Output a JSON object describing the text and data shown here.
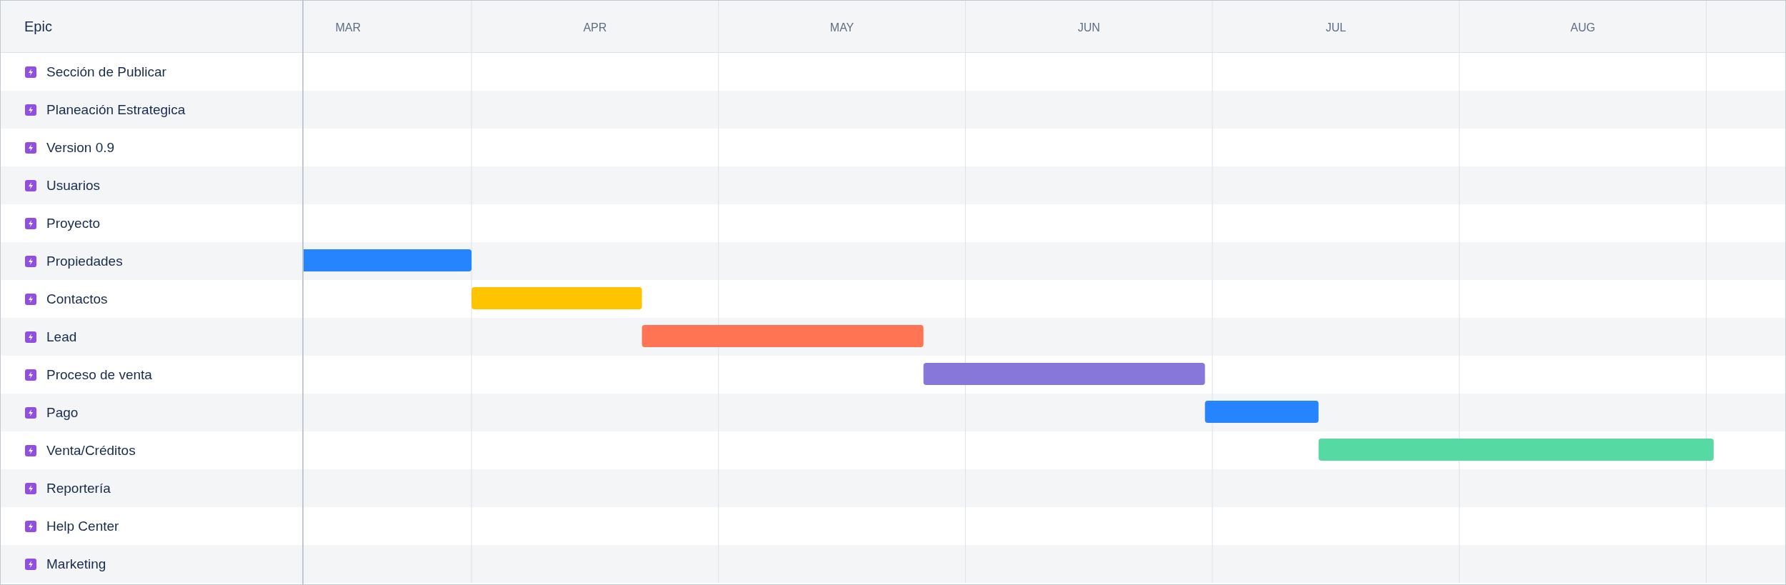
{
  "header": {
    "label": "Epic"
  },
  "epics": [
    {
      "name": "Sección de Publicar"
    },
    {
      "name": "Planeación Estrategica"
    },
    {
      "name": "Version 0.9"
    },
    {
      "name": "Usuarios"
    },
    {
      "name": "Proyecto"
    },
    {
      "name": "Propiedades",
      "bar": {
        "color": "#2684ff"
      }
    },
    {
      "name": "Contactos",
      "bar": {
        "color": "#ffc400"
      }
    },
    {
      "name": "Lead",
      "bar": {
        "color": "#ff7452"
      }
    },
    {
      "name": "Proceso de venta",
      "bar": {
        "color": "#8777d9"
      }
    },
    {
      "name": "Pago",
      "bar": {
        "color": "#2684ff"
      }
    },
    {
      "name": "Venta/Créditos",
      "bar": {
        "color": "#57d9a3"
      }
    },
    {
      "name": "Reportería"
    },
    {
      "name": "Help Center"
    },
    {
      "name": "Marketing"
    }
  ],
  "months": [
    "MAR",
    "APR",
    "MAY",
    "JUN",
    "JUL",
    "AUG"
  ]
}
